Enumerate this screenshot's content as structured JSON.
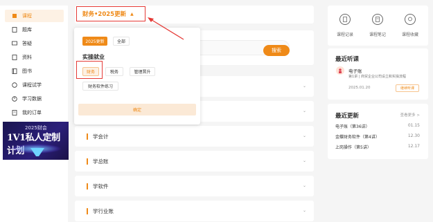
{
  "sidebar": {
    "items": [
      {
        "label": "课程",
        "icon": "course-icon"
      },
      {
        "label": "题库",
        "icon": "question-bank-icon"
      },
      {
        "label": "答疑",
        "icon": "qa-icon"
      },
      {
        "label": "资料",
        "icon": "materials-icon"
      },
      {
        "label": "图书",
        "icon": "book-icon"
      },
      {
        "label": "课程试学",
        "icon": "trial-icon"
      },
      {
        "label": "学习数据",
        "icon": "data-icon"
      },
      {
        "label": "我的订单",
        "icon": "order-icon"
      }
    ],
    "banner": {
      "year": "2025财会",
      "title": "1V1私人定制计划"
    }
  },
  "header": {
    "subject": "财务•2025更新",
    "caret": "▲"
  },
  "search": {
    "button": "搜索"
  },
  "dropdown": {
    "chips_top": [
      "2025更新",
      "全部"
    ],
    "heading": "实操就业",
    "chips": [
      "财务",
      "税务",
      "管理晋升",
      "财务软件练习"
    ],
    "confirm": "确定"
  },
  "categories": [
    "学会计",
    "学总账",
    "学软件",
    "学行业账"
  ],
  "right": {
    "quick": [
      "课程记录",
      "课程笔记",
      "课程收藏"
    ],
    "recent_title": "最近听课",
    "recent": {
      "teacher": "电子账",
      "lesson": "第1讲 | 商贸企业公司设立和实操流程",
      "date": "2025.01.20",
      "action": "继续听课"
    },
    "updates_title": "最近更新",
    "updates_more": "查看更多 >",
    "updates": [
      {
        "name": "电子账（第36讲）",
        "date": "01.15"
      },
      {
        "name": "金蝶财务软件（第4讲）",
        "date": "12.30"
      },
      {
        "name": "上岗操作（第5讲）",
        "date": "12.17"
      }
    ]
  },
  "colors": {
    "accent": "#ef8a18",
    "highlight": "#e53935"
  }
}
